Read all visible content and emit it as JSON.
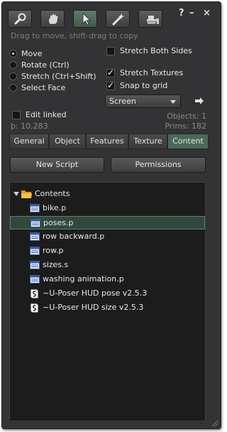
{
  "window": {
    "help_label": "?",
    "minimize_label": "–",
    "close_label": "×"
  },
  "toolbar": {
    "tools": [
      {
        "name": "focus-tool-button",
        "icon": "magnifier-icon",
        "selected": false
      },
      {
        "name": "move-tool-button",
        "icon": "grab-hand-icon",
        "selected": false
      },
      {
        "name": "edit-tool-button",
        "icon": "pointer-cursor-icon",
        "selected": true
      },
      {
        "name": "create-tool-button",
        "icon": "magic-wand-icon",
        "selected": false
      },
      {
        "name": "land-tool-button",
        "icon": "bulldozer-icon",
        "selected": false
      }
    ],
    "hint": "Drag to move, shift-drag to copy"
  },
  "edit_modes": {
    "move": "Move",
    "rotate": "Rotate (Ctrl)",
    "stretch": "Stretch (Ctrl+Shift)",
    "select_face": "Select Face",
    "selected": "move"
  },
  "options": {
    "stretch_both_sides": {
      "label": "Stretch Both Sides",
      "checked": false
    },
    "stretch_textures": {
      "label": "Stretch Textures",
      "checked": true
    },
    "snap_to_grid": {
      "label": "Snap to grid",
      "checked": true
    },
    "grid_mode": "Screen",
    "edit_linked": {
      "label": "Edit linked",
      "checked": false
    }
  },
  "status": {
    "land_impact": "þ: 10,283",
    "objects": "Objects: 1",
    "prims": "Prims: 182"
  },
  "tabs": [
    {
      "label": "General",
      "active": false
    },
    {
      "label": "Object",
      "active": false
    },
    {
      "label": "Features",
      "active": false
    },
    {
      "label": "Texture",
      "active": false
    },
    {
      "label": "Content",
      "active": true
    }
  ],
  "content_panel": {
    "new_script_label": "New Script",
    "permissions_label": "Permissions",
    "folder_label": "Contents",
    "items": [
      {
        "label": "bike.p",
        "icon": "notecard-icon",
        "selected": false
      },
      {
        "label": "poses.p",
        "icon": "notecard-icon",
        "selected": true
      },
      {
        "label": "row backward.p",
        "icon": "notecard-icon",
        "selected": false
      },
      {
        "label": "row.p",
        "icon": "notecard-icon",
        "selected": false
      },
      {
        "label": "sizes.s",
        "icon": "notecard-icon",
        "selected": false
      },
      {
        "label": "washing animation.p",
        "icon": "notecard-icon",
        "selected": false
      },
      {
        "label": "~U-Poser HUD pose v2.5.3",
        "icon": "script-icon",
        "selected": false
      },
      {
        "label": "~U-Poser HUD size v2.5.3",
        "icon": "script-icon",
        "selected": false
      }
    ]
  },
  "colors": {
    "panel_bg": "#333335",
    "accent_selected": "#4a6a58",
    "list_bg": "#1c1c1c"
  }
}
